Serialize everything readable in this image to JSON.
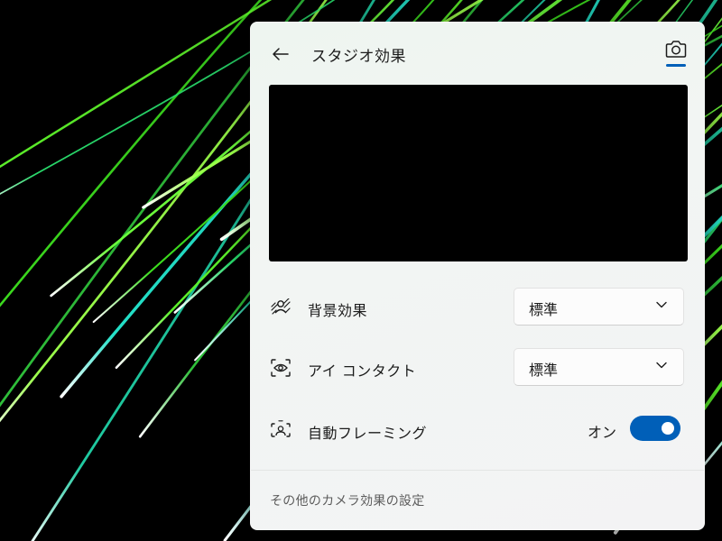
{
  "panel": {
    "title": "スタジオ効果",
    "back_icon": "arrow-left-icon",
    "camera_icon": "camera-icon"
  },
  "preview": {
    "state": "black camera preview"
  },
  "settings": [
    {
      "icon": "background-effects-icon",
      "label": "背景効果",
      "value": "標準"
    },
    {
      "icon": "eye-contact-icon",
      "label": "アイ コンタクト",
      "value": "標準"
    },
    {
      "icon": "auto-framing-icon",
      "label": "自動フレーミング",
      "state": "オン",
      "toggle_on": true
    }
  ],
  "footer": {
    "link": "その他のカメラ効果の設定"
  },
  "colors": {
    "accent": "#005fb8",
    "panel_bg": "#f2f5f3",
    "wallpaper_streaks": "#3cdc1e"
  }
}
